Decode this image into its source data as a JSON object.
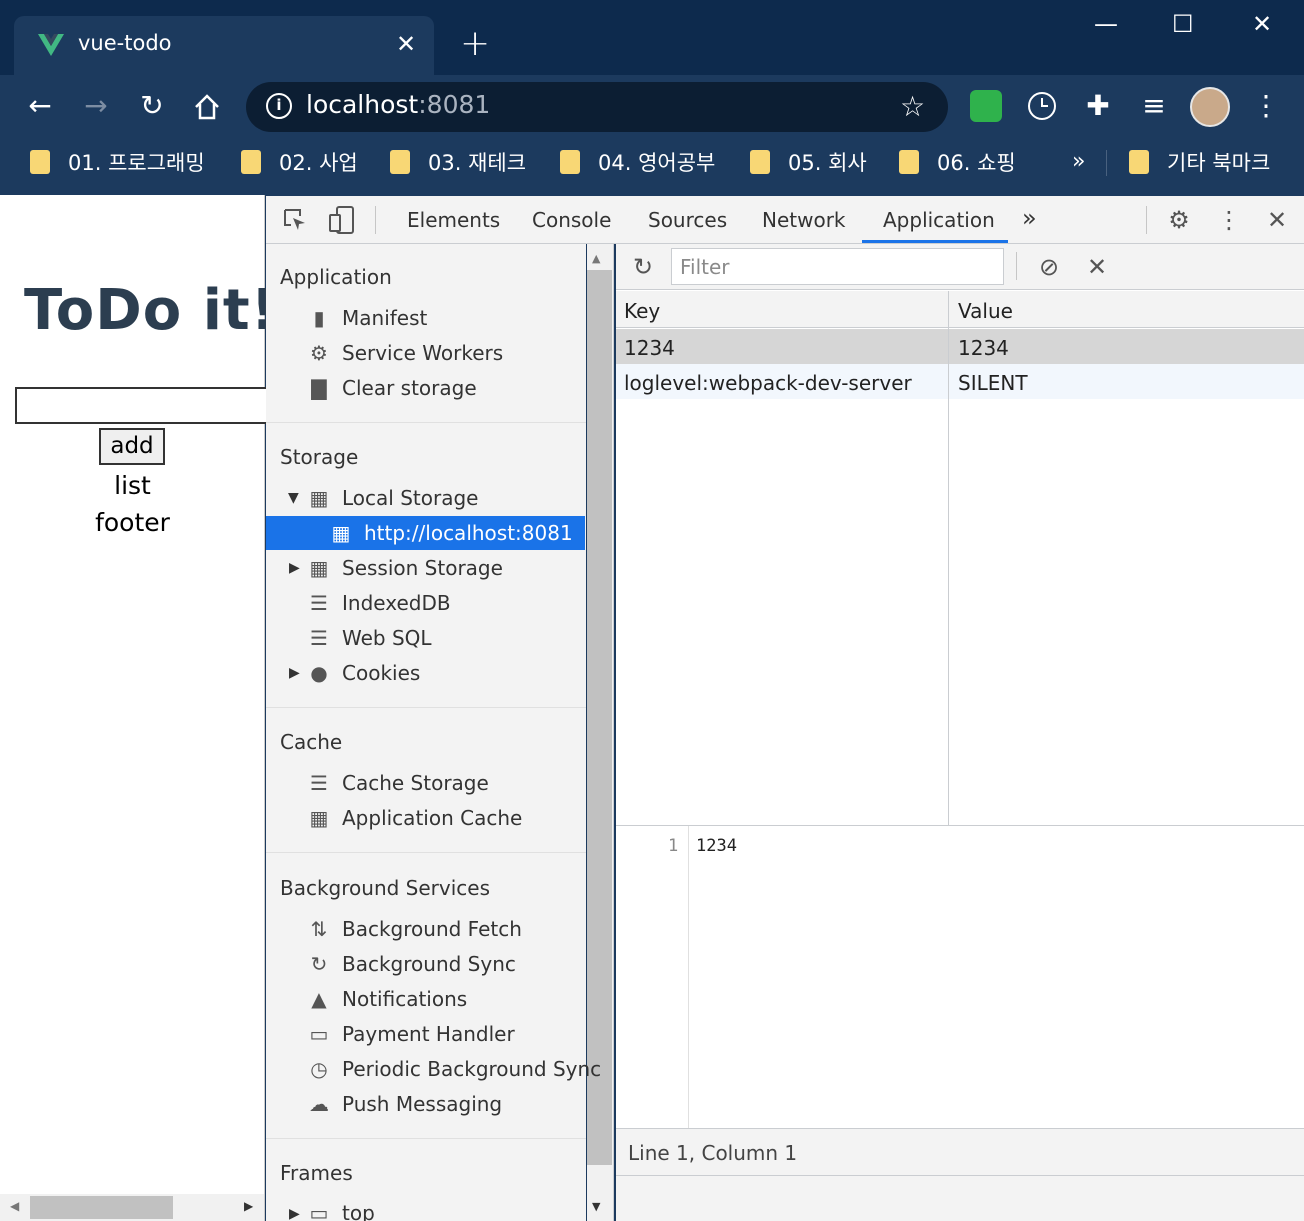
{
  "browser": {
    "tab_title": "vue-todo",
    "tab_close": "✕",
    "new_tab": "+",
    "window_controls": {
      "minimize": "—",
      "maximize": "☐",
      "close": "✕"
    },
    "url_host": "localhost",
    "url_port": ":8081",
    "bookmarks": [
      "01. 프로그래밍",
      "02. 사업",
      "03. 재테크",
      "04. 영어공부",
      "05. 회사",
      "06. 쇼핑"
    ],
    "bookmarks_overflow": "»",
    "other_bookmarks": "기타 북마크"
  },
  "page": {
    "title": "ToDo it!",
    "add_button": "add",
    "list_text": "list",
    "footer_text": "footer"
  },
  "devtools": {
    "tabs": [
      "Elements",
      "Console",
      "Sources",
      "Network",
      "Application"
    ],
    "active_tab": "Application",
    "more_tabs": "»",
    "sidebar": {
      "application_header": "Application",
      "application_items": [
        "Manifest",
        "Service Workers",
        "Clear storage"
      ],
      "storage_header": "Storage",
      "local_storage": "Local Storage",
      "local_storage_origin": "http://localhost:8081",
      "session_storage": "Session Storage",
      "indexeddb": "IndexedDB",
      "websql": "Web SQL",
      "cookies": "Cookies",
      "cache_header": "Cache",
      "cache_items": [
        "Cache Storage",
        "Application Cache"
      ],
      "bg_header": "Background Services",
      "bg_items": [
        "Background Fetch",
        "Background Sync",
        "Notifications",
        "Payment Handler",
        "Periodic Background Sync",
        "Push Messaging"
      ],
      "frames_header": "Frames",
      "frames_top": "top"
    },
    "filter_placeholder": "Filter",
    "table": {
      "columns": [
        "Key",
        "Value"
      ],
      "rows": [
        {
          "key": "1234",
          "value": "1234"
        },
        {
          "key": "loglevel:webpack-dev-server",
          "value": "SILENT"
        }
      ]
    },
    "preview": {
      "line_number": "1",
      "content": "1234"
    },
    "status": "Line 1, Column 1"
  },
  "colors": {
    "accent": "#1a73e8",
    "title_bar": "#0d2a4d",
    "toolbar": "#1c3a5e",
    "todo_title": "#2c3e50"
  }
}
